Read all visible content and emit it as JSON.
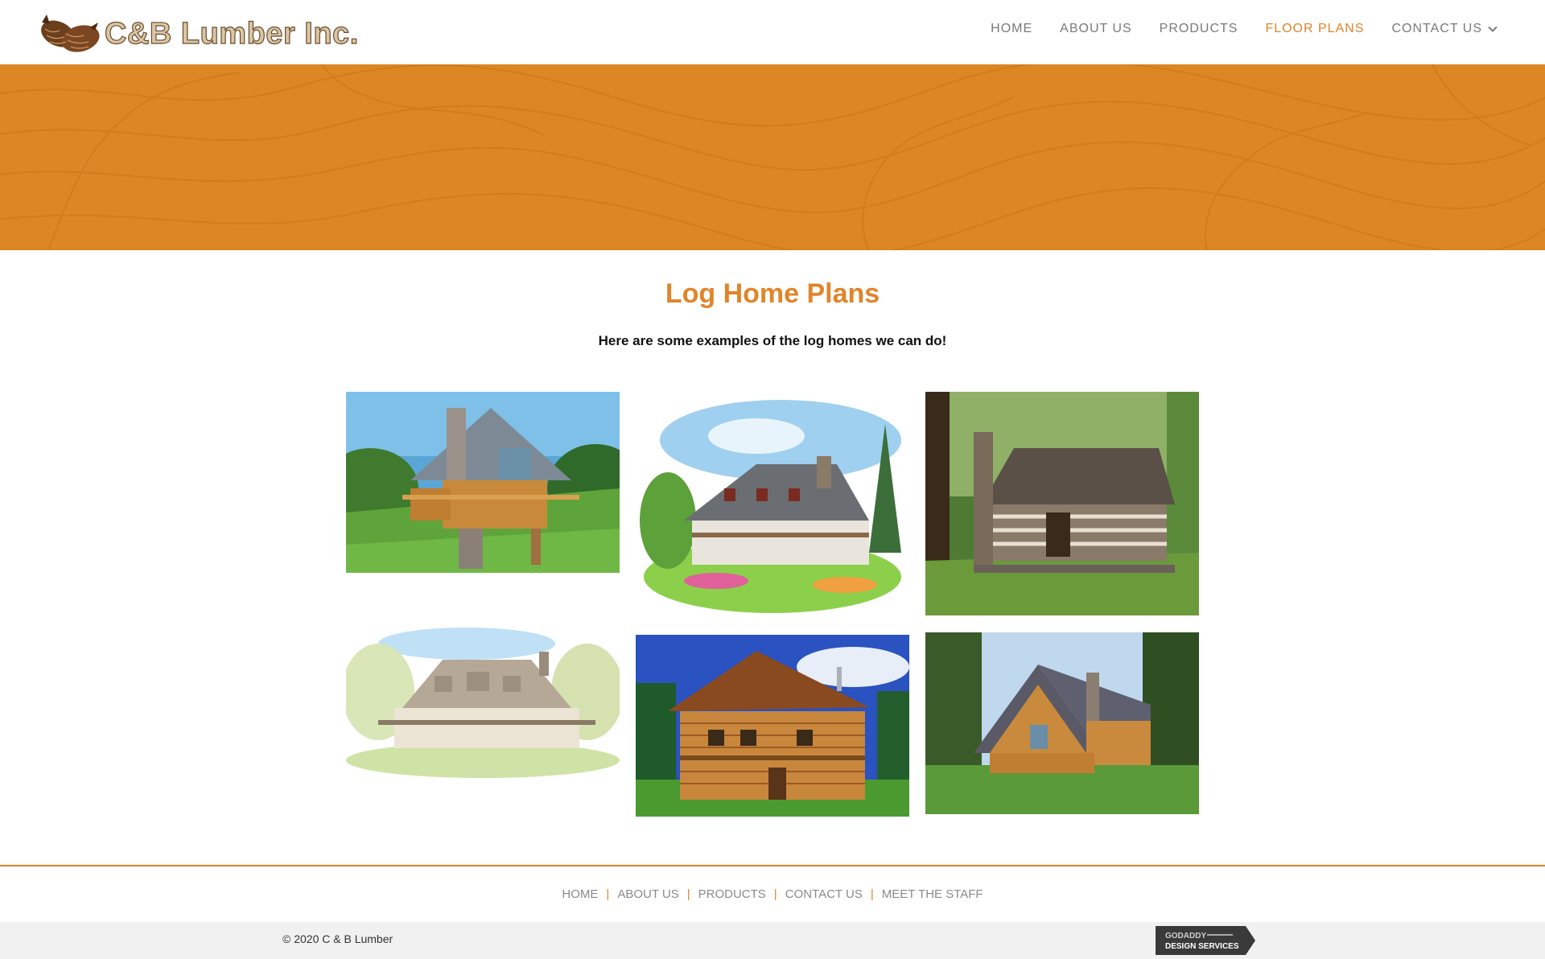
{
  "header": {
    "logo_text": "C&B Lumber Inc.",
    "nav": [
      {
        "label": "HOME"
      },
      {
        "label": "ABOUT US"
      },
      {
        "label": "PRODUCTS"
      },
      {
        "label": "FLOOR PLANS",
        "active": true
      },
      {
        "label": "CONTACT US",
        "has_dropdown": true
      }
    ]
  },
  "hero": {
    "color": "#dd8625"
  },
  "main": {
    "title": "Log Home Plans",
    "subtitle": "Here are some examples of the log homes we can do!",
    "gallery": [
      {
        "name": "log-home-chalet-hillside"
      },
      {
        "name": "cottage-watercolor"
      },
      {
        "name": "rustic-log-cabin-woods"
      },
      {
        "name": "farmhouse-sketch"
      },
      {
        "name": "two-story-log-home"
      },
      {
        "name": "a-frame-log-cabin"
      }
    ]
  },
  "footer": {
    "links": [
      "HOME",
      "ABOUT US",
      "PRODUCTS",
      "CONTACT US",
      "MEET THE STAFF"
    ],
    "copyright": "© 2020 C & B Lumber",
    "badge_line1": "GODADDY",
    "badge_line2": "DESIGN SERVICES"
  },
  "colors": {
    "accent": "#e0852a",
    "hero": "#dd8625"
  }
}
